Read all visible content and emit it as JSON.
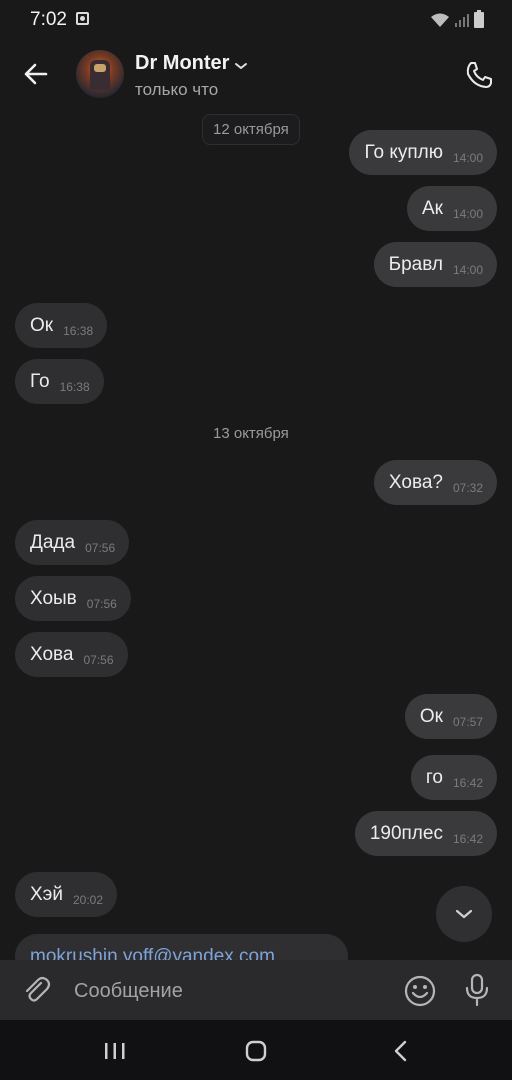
{
  "status_bar": {
    "time": "7:02"
  },
  "header": {
    "contact_name": "Dr Monter",
    "contact_status": "только что"
  },
  "messages": [
    {
      "type": "date",
      "text": "12 октября"
    },
    {
      "direction": "out",
      "text": "Го куплю",
      "time": "14:00"
    },
    {
      "direction": "out",
      "text": "Ак",
      "time": "14:00"
    },
    {
      "direction": "out",
      "text": "Бравл",
      "time": "14:00"
    },
    {
      "direction": "in",
      "text": "Ок",
      "time": "16:38"
    },
    {
      "direction": "in",
      "text": "Го",
      "time": "16:38"
    },
    {
      "type": "date",
      "text": "13 октября"
    },
    {
      "direction": "out",
      "text": "Хова?",
      "time": "07:32"
    },
    {
      "direction": "in",
      "text": "Дада",
      "time": "07:56"
    },
    {
      "direction": "in",
      "text": "Хоыв",
      "time": "07:56"
    },
    {
      "direction": "in",
      "text": "Хова",
      "time": "07:56"
    },
    {
      "direction": "out",
      "text": "Ок",
      "time": "07:57"
    },
    {
      "direction": "out",
      "text": "го",
      "time": "16:42"
    },
    {
      "direction": "out",
      "text": "190плес",
      "time": "16:42"
    },
    {
      "direction": "in",
      "text": "Хэй",
      "time": "20:02"
    },
    {
      "direction": "in",
      "text": "mokrushin.yoff@yandex.com",
      "time": ""
    }
  ],
  "composer": {
    "placeholder": "Сообщение"
  },
  "icons": {
    "back": "arrow-left-icon",
    "call": "phone-icon",
    "attach": "paperclip-icon",
    "emoji": "smiley-icon",
    "mic": "microphone-icon",
    "scroll": "chevron-down-icon"
  }
}
